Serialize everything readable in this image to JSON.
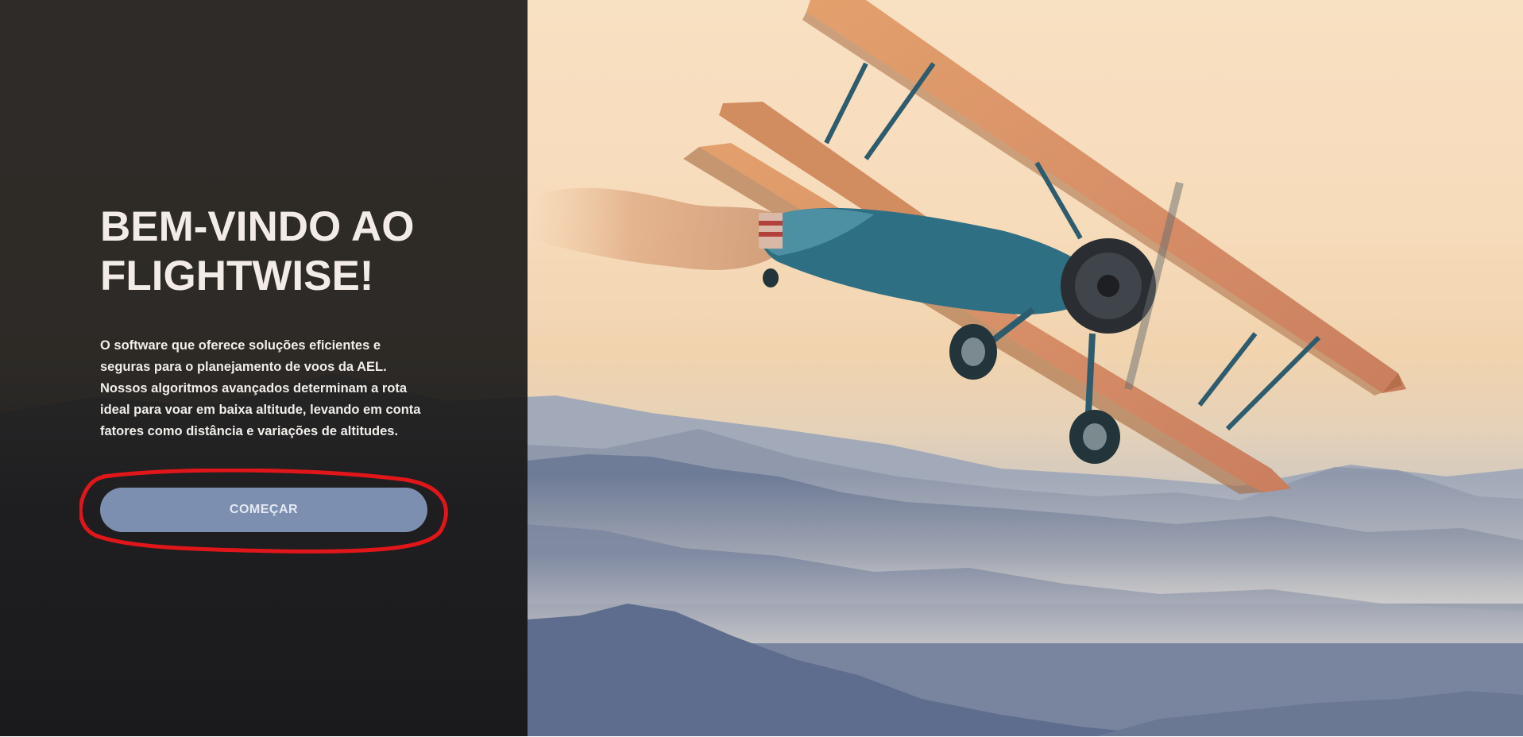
{
  "hero": {
    "title_line1": "BEM-VINDO AO",
    "title_line2": "FLIGHTWISE!",
    "description": "O software que oferece soluções eficientes e seguras para o planejamento de voos da AEL. Nossos algoritmos avançados determinam a rota ideal para voar em baixa altitude, levando em conta fatores como distância e variações de altitudes.",
    "cta_label": "COMEÇAR"
  },
  "colors": {
    "panel_background": "#1e1d1c",
    "button_background": "#7d8fb0",
    "button_text": "#e4e9f2",
    "annotation_stroke": "#e0161b",
    "title_text": "#f3ece6"
  },
  "icons": {
    "hero_image": "biplane-over-mountains-photo"
  }
}
